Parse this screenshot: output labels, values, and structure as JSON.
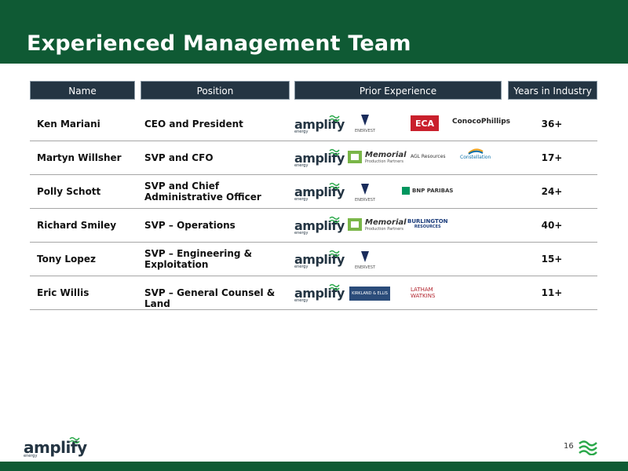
{
  "title": "Experienced Management Team",
  "columns": [
    "Name",
    "Position",
    "Prior Experience",
    "Years in Industry"
  ],
  "rows": [
    {
      "name": "Ken Mariani",
      "position": "CEO and President",
      "years": "36+",
      "logos": [
        "amplify",
        "EnerVest",
        "ECA",
        "ConocoPhillips"
      ]
    },
    {
      "name": "Martyn Willsher",
      "position": "SVP and CFO",
      "years": "17+",
      "logos": [
        "amplify",
        "Memorial Production Partners",
        "AGL Resources",
        "Constellation"
      ]
    },
    {
      "name": "Polly Schott",
      "position": "SVP and Chief Administrative Officer",
      "years": "24+",
      "logos": [
        "amplify",
        "EnerVest",
        "BNP PARIBAS"
      ]
    },
    {
      "name": "Richard Smiley",
      "position": "SVP – Operations",
      "years": "40+",
      "logos": [
        "amplify",
        "Memorial Production Partners",
        "Burlington Resources"
      ]
    },
    {
      "name": "Tony Lopez",
      "position": "SVP – Engineering & Exploitation",
      "years": "15+",
      "logos": [
        "amplify",
        "EnerVest"
      ]
    },
    {
      "name": "Eric Willis",
      "position": "SVP – General Counsel & Land",
      "years": "11+",
      "logos": [
        "amplify",
        "Kirkland & Ellis",
        "Latham & Watkins"
      ]
    }
  ],
  "logo_text": {
    "amplify": "amplify",
    "amplify_sub": "energy",
    "enervest": "ENERVEST",
    "eca": "ECA",
    "conoco": "ConocoPhillips",
    "memorial": "Memorial",
    "memorial_sub": "Production Partners",
    "agl": "AGL Resources",
    "constellation": "Constellation",
    "bnp": "BNP PARIBAS",
    "burl_1": "BURLINGTON",
    "burl_2": "RESOURCES",
    "kirkland": "KIRKLAND & ELLIS",
    "latham_1": "LATHAM",
    "latham_2": "WATKINS"
  },
  "page_number": "16",
  "colors": {
    "brand_green": "#0f5a34",
    "header_navy": "#243543",
    "amplify_wave": "#2aa84a"
  }
}
